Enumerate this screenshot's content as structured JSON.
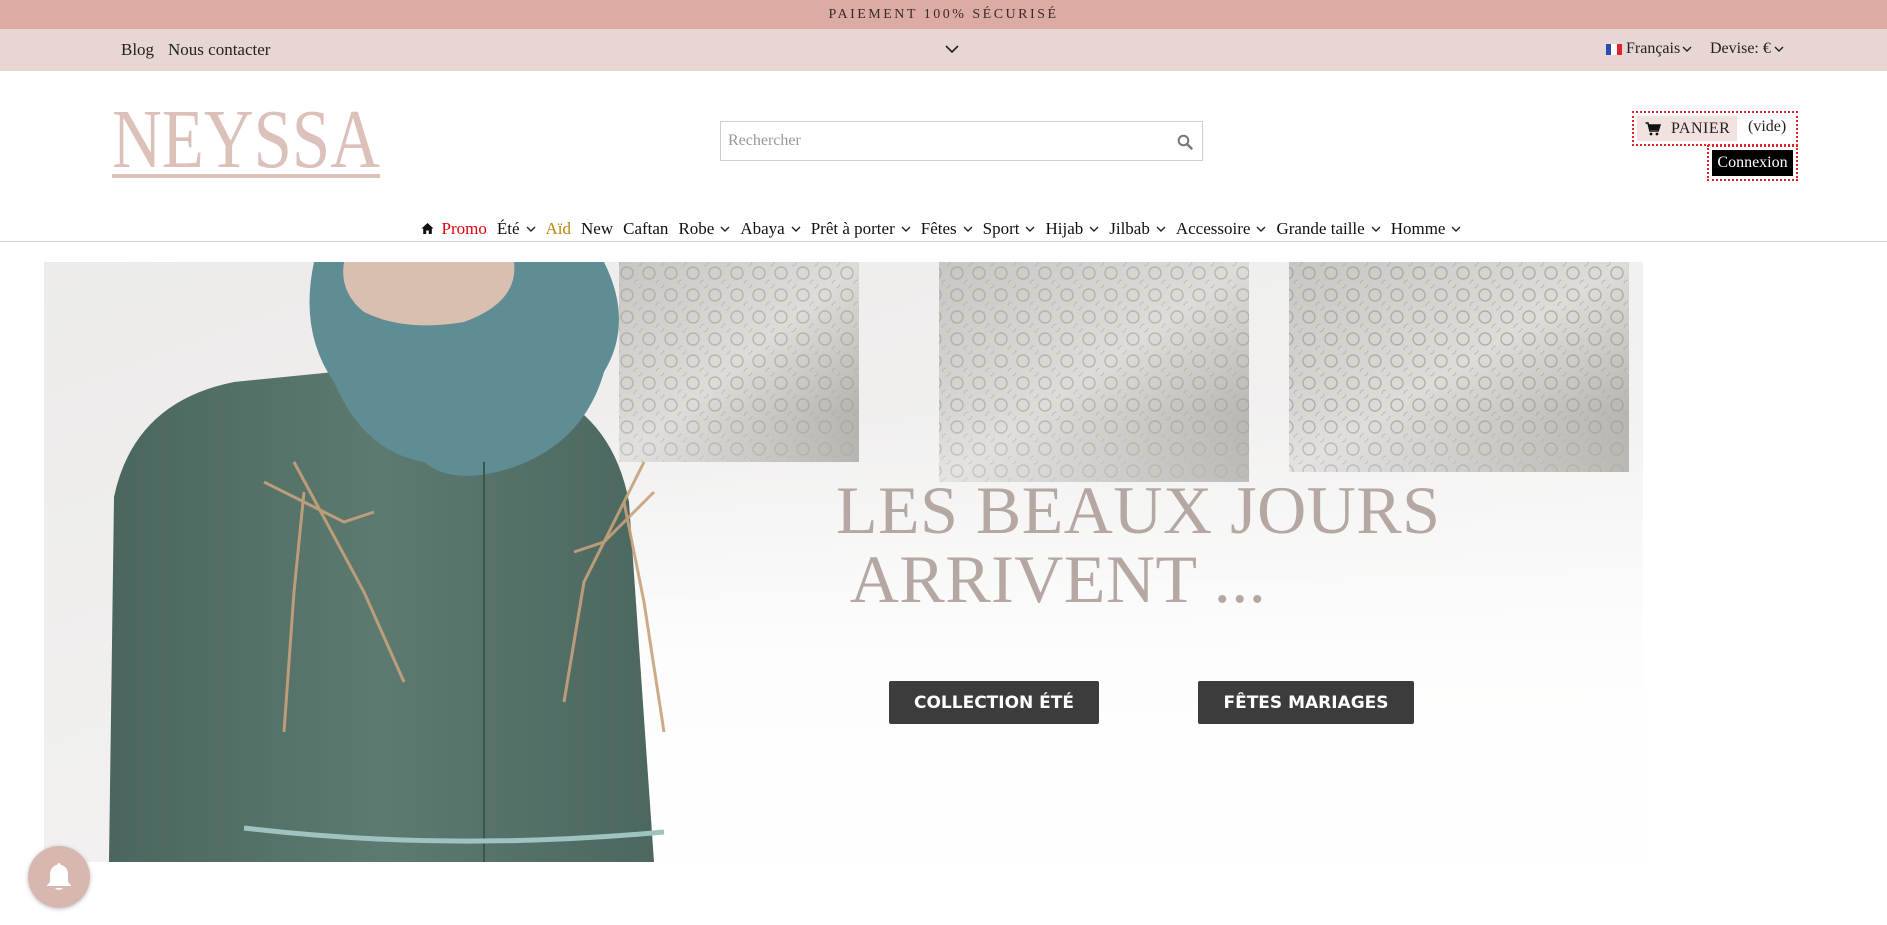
{
  "promo_bar": {
    "text": "PAIEMENT 100% SÉCURISÉ"
  },
  "top_nav": {
    "links": [
      {
        "label": "Blog"
      },
      {
        "label": "Nous contacter"
      }
    ],
    "language": {
      "label": "Français",
      "flag_icon": "france-flag-icon"
    },
    "currency": {
      "label": "Devise: €"
    }
  },
  "header": {
    "logo_text": "NEYSSA",
    "search": {
      "placeholder": "Rechercher",
      "value": ""
    },
    "cart": {
      "label": "PANIER",
      "count": "(vide)"
    },
    "login": {
      "label": "Connexion"
    }
  },
  "main_nav": {
    "items": [
      {
        "label": "Promo",
        "color": "#e0000f",
        "dropdown": false
      },
      {
        "label": "Été",
        "color": "#111111",
        "dropdown": true
      },
      {
        "label": "Aïd",
        "color": "#b8860b",
        "dropdown": false
      },
      {
        "label": "New",
        "color": "#111111",
        "dropdown": false
      },
      {
        "label": "Caftan",
        "color": "#111111",
        "dropdown": false
      },
      {
        "label": "Robe",
        "color": "#111111",
        "dropdown": true
      },
      {
        "label": "Abaya",
        "color": "#111111",
        "dropdown": true
      },
      {
        "label": "Prêt à porter",
        "color": "#111111",
        "dropdown": true
      },
      {
        "label": "Fêtes",
        "color": "#111111",
        "dropdown": true
      },
      {
        "label": "Sport",
        "color": "#111111",
        "dropdown": true
      },
      {
        "label": "Hijab",
        "color": "#111111",
        "dropdown": true
      },
      {
        "label": "Jilbab",
        "color": "#111111",
        "dropdown": true
      },
      {
        "label": "Accessoire",
        "color": "#111111",
        "dropdown": true
      },
      {
        "label": "Grande taille",
        "color": "#111111",
        "dropdown": true
      },
      {
        "label": "Homme",
        "color": "#111111",
        "dropdown": true
      }
    ]
  },
  "hero": {
    "headline": "LES BEAUX JOURS\n ARRIVENT ...",
    "buttons": {
      "summer": "COLLECTION ÉTÉ",
      "weddings": "FÊTES MARIAGES"
    }
  },
  "colors": {
    "promo_bar": "#dcaca4",
    "top_nav": "#e8d6d4",
    "logo": "#dcc0ba",
    "headline": "#b5a8a2",
    "button": "#3c3c3c"
  }
}
